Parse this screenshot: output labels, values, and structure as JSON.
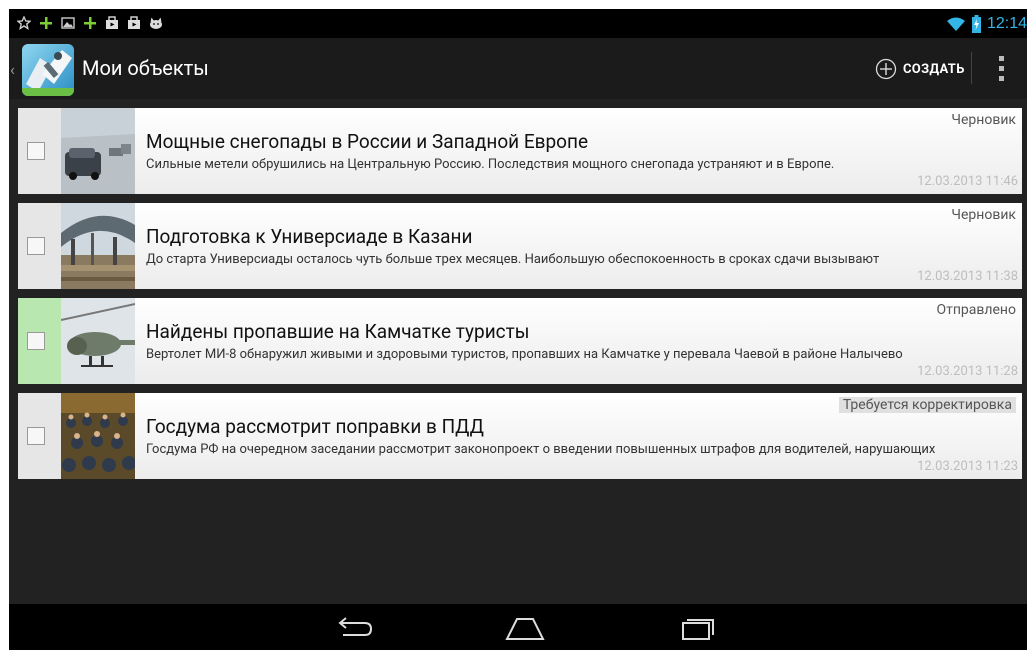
{
  "status_bar": {
    "time": "12:14",
    "left_icons": [
      "star-icon",
      "plus-icon",
      "image-icon",
      "plus-icon",
      "bag-icon",
      "bag-icon",
      "cat-icon"
    ]
  },
  "action_bar": {
    "title": "Мои объекты",
    "create_label": "СОЗДАТЬ"
  },
  "items": [
    {
      "title": "Мощные снегопады в России и Западной Европе",
      "description": "Сильные метели обрушились на Центральную Россию. Последствия мощного снегопада устраняют и в Европе.",
      "status": "Черновик",
      "date": "12.03.2013 11:46"
    },
    {
      "title": "Подготовка к Универсиаде в Казани",
      "description": "До  старта Универсиады осталось чуть больше трех месяцев. Наибольшую обеспокоенность в сроках сдачи вызывают",
      "status": "Черновик",
      "date": "12.03.2013 11:38"
    },
    {
      "title": "Найдены пропавшие на Камчатке туристы",
      "description": "Вертолет МИ-8 обнаружил живыми и здоровыми туристов, пропавших на Камчатке у перевала Чаевой в районе Налычево",
      "status": "Отправлено",
      "date": "12.03.2013 11:28"
    },
    {
      "title": "Госдума рассмотрит поправки в ПДД",
      "description": "Госдума РФ на очередном заседании рассмотрит законопроект о введении повышенных штрафов для водителей, нарушающих",
      "status": "Требуется корректировка",
      "date": "12.03.2013 11:23"
    }
  ],
  "colors": {
    "accent": "#33b5e5",
    "sent_highlight": "#b8e8b0",
    "action_bar": "#1b1b1b",
    "content_bg": "#222222"
  }
}
